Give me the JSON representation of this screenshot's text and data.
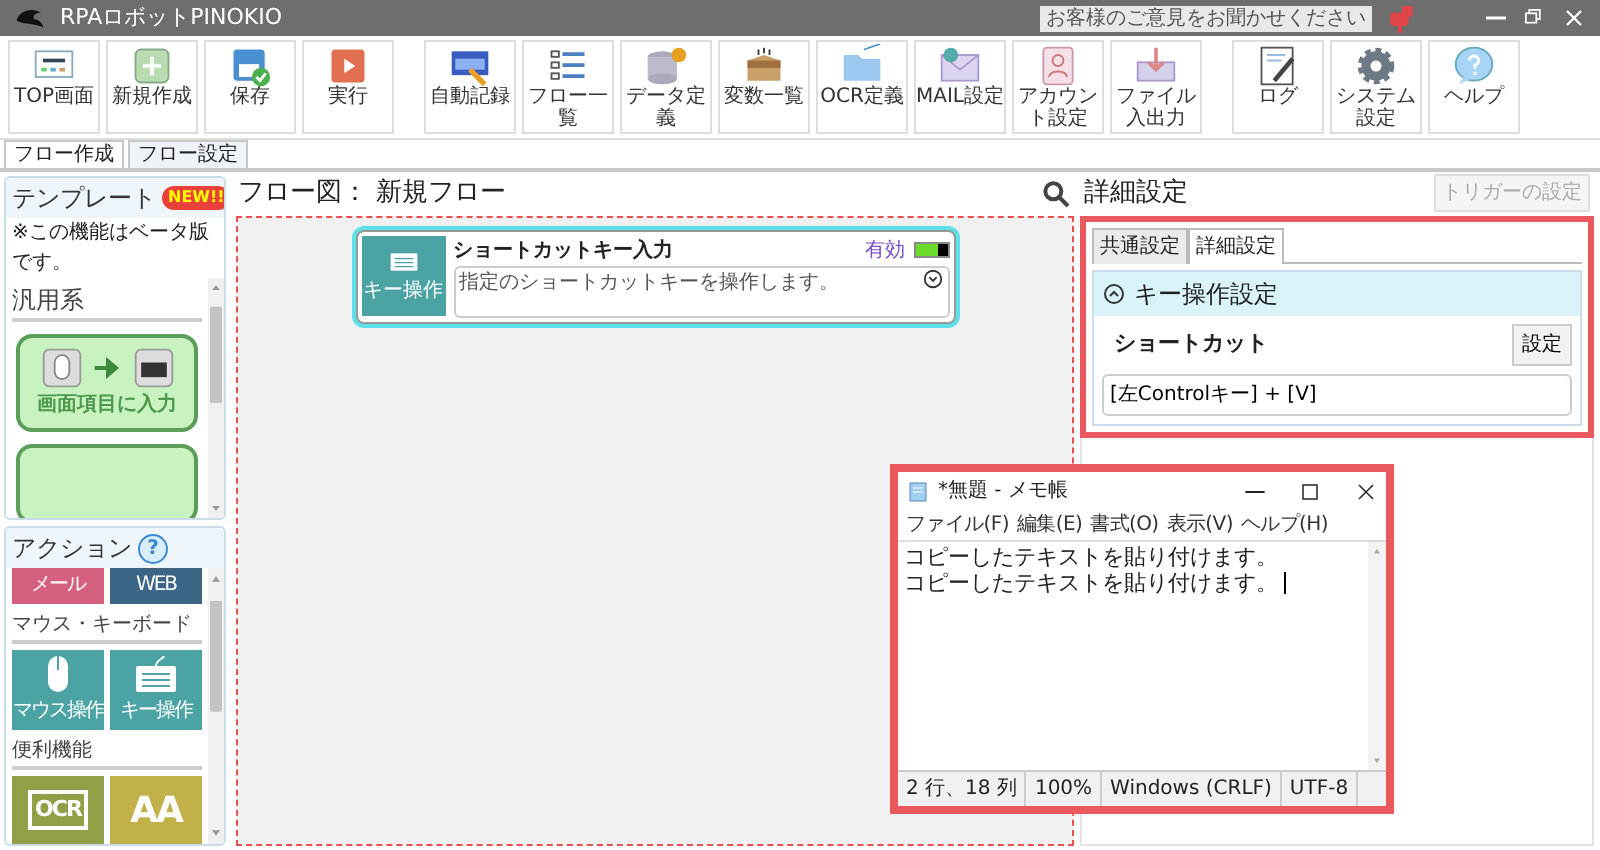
{
  "title_bar": {
    "title": "RPAロボットPINOKIO",
    "feedback": "お客様のご意見をお聞かせください"
  },
  "toolbar_groups": [
    {
      "buttons": [
        {
          "label": "TOP画面",
          "kind": "top"
        },
        {
          "label": "新規作成",
          "kind": "new"
        },
        {
          "label": "保存",
          "kind": "save"
        },
        {
          "label": "実行",
          "kind": "run"
        }
      ]
    },
    {
      "buttons": [
        {
          "label": "自動記録",
          "kind": "record"
        },
        {
          "label": "フロー一覧",
          "kind": "list"
        },
        {
          "label": "データ定義",
          "kind": "data"
        },
        {
          "label": "変数一覧",
          "kind": "vars"
        },
        {
          "label": "OCR定義",
          "kind": "ocr"
        },
        {
          "label": "MAIL設定",
          "kind": "mail"
        },
        {
          "label": "アカウント設定",
          "kind": "account"
        },
        {
          "label": "ファイル入出力",
          "kind": "file"
        }
      ]
    },
    {
      "buttons": [
        {
          "label": "ログ",
          "kind": "log"
        },
        {
          "label": "システム設定",
          "kind": "system"
        },
        {
          "label": "ヘルプ",
          "kind": "help"
        }
      ]
    }
  ],
  "page_tabs": [
    {
      "label": "フロー作成",
      "selected": true
    },
    {
      "label": "フロー設定",
      "selected": false
    }
  ],
  "template_panel": {
    "title": "テンプレート",
    "badge": "NEW!!",
    "note": "※この機能はベータ版です。",
    "category": "汎用系",
    "templates": [
      {
        "kind": "mouse-to-key",
        "label": "画面項目に入力"
      },
      {
        "kind": "partial"
      }
    ]
  },
  "action_panel": {
    "title": "アクション",
    "help": "?",
    "sections": [
      {
        "tiles": [
          {
            "kind": "mail",
            "label": "メール",
            "color": "#d6607f"
          },
          {
            "kind": "web",
            "label": "WEB",
            "color": "#3d6686"
          }
        ]
      },
      {
        "heading": "マウス・キーボード",
        "tiles": [
          {
            "kind": "mouse",
            "label": "マウス操作",
            "color": "#4ba3a3"
          },
          {
            "kind": "keyboard",
            "label": "キー操作",
            "color": "#4ba3a3"
          }
        ]
      },
      {
        "heading": "便利機能",
        "tiles": [
          {
            "kind": "ocr",
            "label": "OCR",
            "color": "#8fa046"
          },
          {
            "kind": "font",
            "label": "AA",
            "color": "#c2b048"
          }
        ]
      }
    ]
  },
  "flow": {
    "title": "フロー図： 新規フロー",
    "nodes": [
      {
        "title": "ショートカットキー入力",
        "icon_label": "キー操作",
        "status": "有効",
        "enabled": true,
        "selected": true,
        "description": "指定のショートカットキーを操作します。"
      }
    ]
  },
  "details": {
    "title": "詳細設定",
    "trigger_button": {
      "label": "トリガーの設定",
      "disabled": true
    },
    "tabs": [
      {
        "label": "共通設定",
        "selected": false
      },
      {
        "label": "詳細設定",
        "selected": true
      }
    ],
    "section": {
      "title": "キー操作設定",
      "expanded": true,
      "label": "ショートカット",
      "button": "設定",
      "value": "[左Controlキー] + [V]"
    }
  },
  "notepad": {
    "title": "*無題 - メモ帳",
    "menu": [
      "ファイル(F)",
      "編集(E)",
      "書式(O)",
      "表示(V)",
      "ヘルプ(H)"
    ],
    "lines": [
      "コピーしたテキストを貼り付けます。",
      "コピーしたテキストを貼り付けます。"
    ],
    "status": [
      "2 行、18 列",
      "100%",
      "Windows (CRLF)",
      "UTF-8"
    ]
  }
}
